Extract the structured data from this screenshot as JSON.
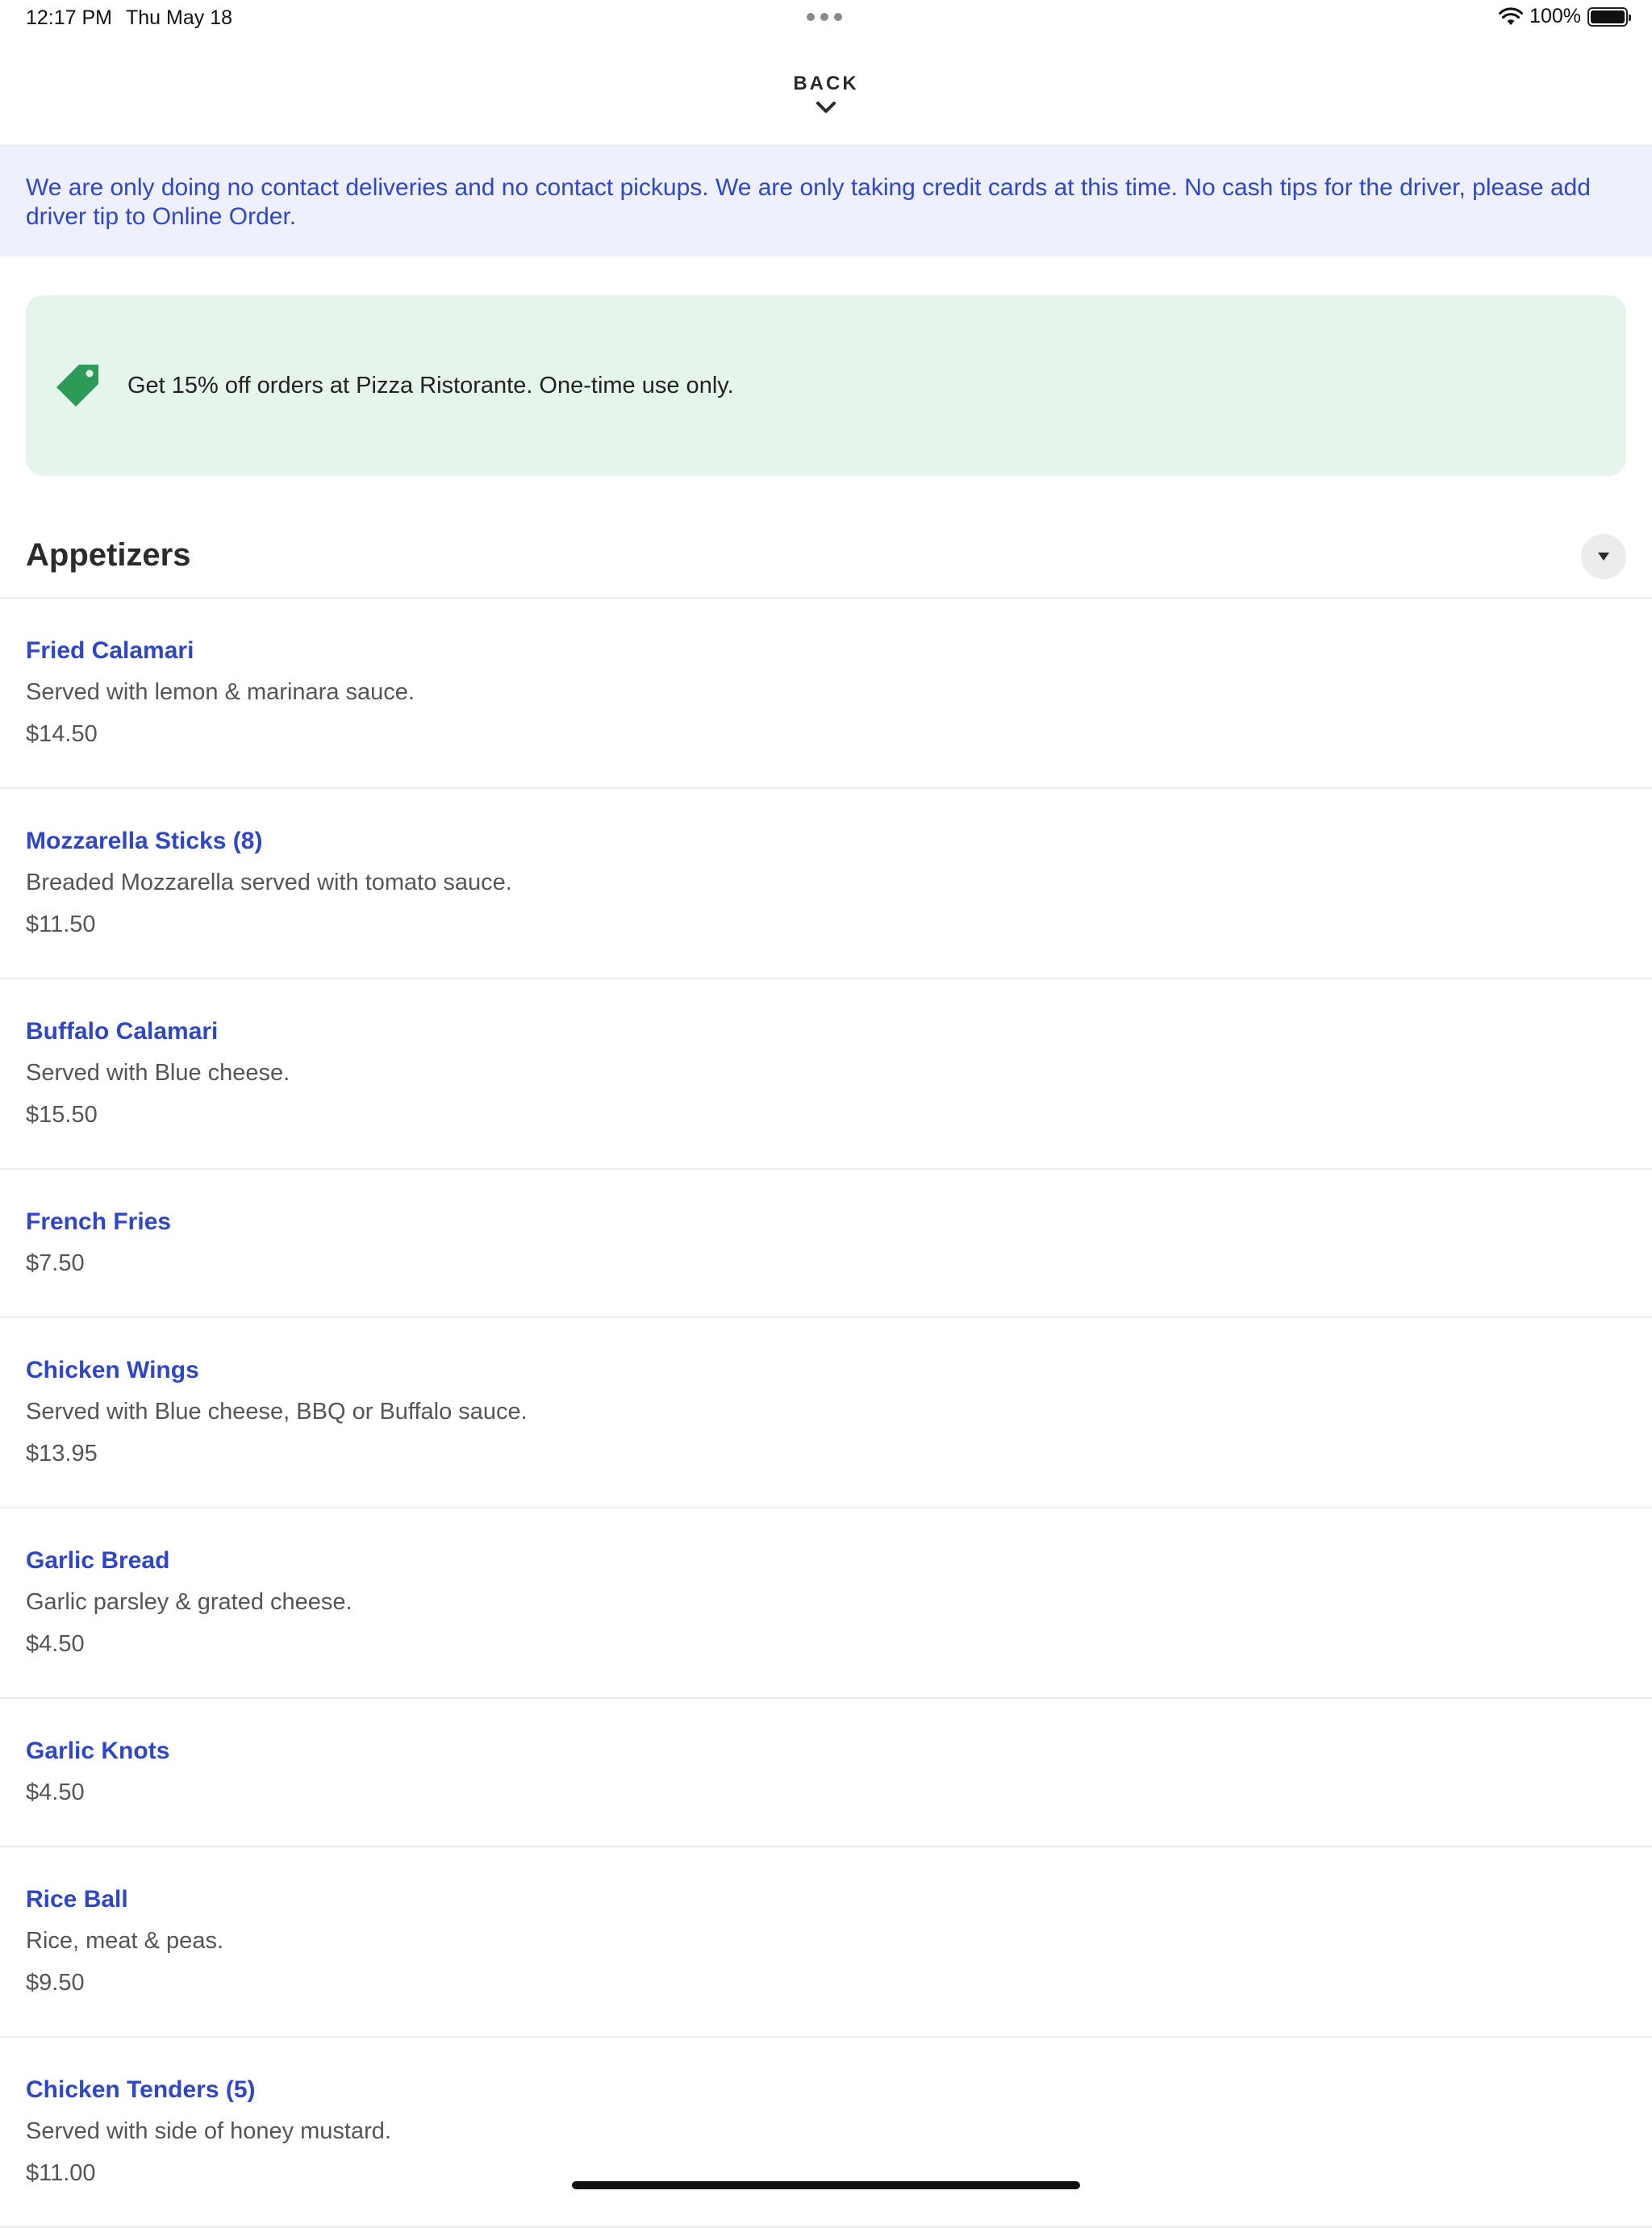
{
  "status_bar": {
    "time": "12:17 PM",
    "date": "Thu May 18",
    "battery": "100%"
  },
  "nav": {
    "back_label": "BACK"
  },
  "notice": {
    "text": "We are only doing no contact deliveries and no contact pickups. We are only taking credit cards at this time. No cash tips for the driver, please add driver tip to Online Order."
  },
  "promo": {
    "text": "Get 15% off orders at Pizza Ristorante. One-time use only.",
    "icon": "tag-icon",
    "color": "#2e9a57"
  },
  "section": {
    "title": "Appetizers"
  },
  "menu_items": [
    {
      "name": "Fried Calamari",
      "description": "Served with lemon & marinara sauce.",
      "price": "$14.50"
    },
    {
      "name": "Mozzarella Sticks (8)",
      "description": "Breaded Mozzarella served with tomato sauce.",
      "price": "$11.50"
    },
    {
      "name": "Buffalo Calamari",
      "description": "Served with Blue cheese.",
      "price": "$15.50"
    },
    {
      "name": "French Fries",
      "description": "",
      "price": "$7.50"
    },
    {
      "name": "Chicken Wings",
      "description": "Served with Blue cheese, BBQ or Buffalo sauce.",
      "price": "$13.95"
    },
    {
      "name": "Garlic Bread",
      "description": "Garlic parsley & grated cheese.",
      "price": "$4.50"
    },
    {
      "name": "Garlic Knots",
      "description": "",
      "price": "$4.50"
    },
    {
      "name": "Rice Ball",
      "description": "Rice, meat & peas.",
      "price": "$9.50"
    },
    {
      "name": "Chicken Tenders (5)",
      "description": "Served with side of honey mustard.",
      "price": "$11.00"
    }
  ],
  "colors": {
    "accent": "#2f47c7",
    "notice_bg": "#eef0fd",
    "promo_bg": "#e6f5ec"
  }
}
